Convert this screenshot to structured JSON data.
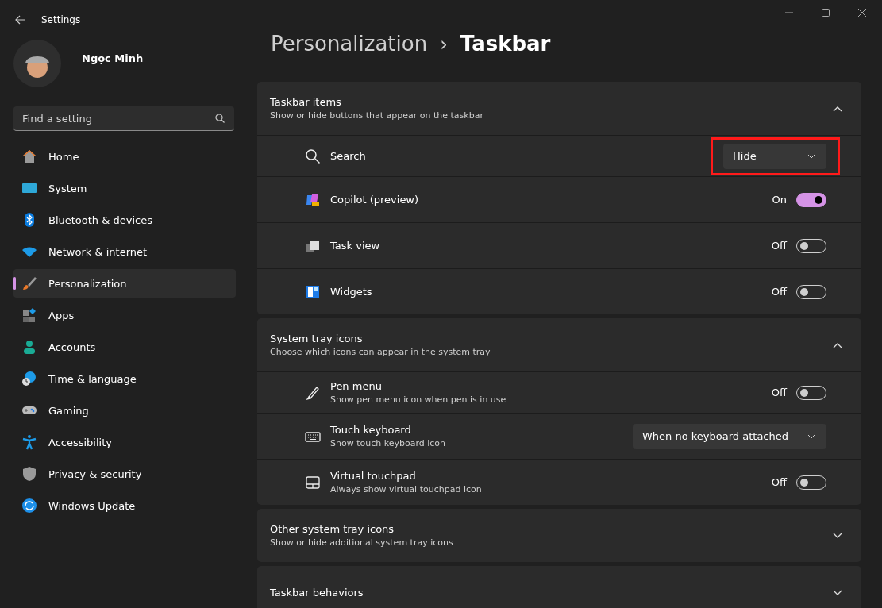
{
  "window": {
    "title": "Settings"
  },
  "user": {
    "name": "Ngọc Minh"
  },
  "search": {
    "placeholder": "Find a setting"
  },
  "sidebar": {
    "items": [
      {
        "label": "Home",
        "selected": false
      },
      {
        "label": "System",
        "selected": false
      },
      {
        "label": "Bluetooth & devices",
        "selected": false
      },
      {
        "label": "Network & internet",
        "selected": false
      },
      {
        "label": "Personalization",
        "selected": true
      },
      {
        "label": "Apps",
        "selected": false
      },
      {
        "label": "Accounts",
        "selected": false
      },
      {
        "label": "Time & language",
        "selected": false
      },
      {
        "label": "Gaming",
        "selected": false
      },
      {
        "label": "Accessibility",
        "selected": false
      },
      {
        "label": "Privacy & security",
        "selected": false
      },
      {
        "label": "Windows Update",
        "selected": false
      }
    ]
  },
  "breadcrumb": {
    "parent": "Personalization",
    "separator": "›",
    "current": "Taskbar"
  },
  "sections": [
    {
      "title": "Taskbar items",
      "subtitle": "Show or hide buttons that appear on the taskbar",
      "expanded": true,
      "rows": [
        {
          "kind": "dropdown",
          "label": "Search",
          "value": "Hide",
          "highlighted": true
        },
        {
          "kind": "toggle",
          "label": "Copilot (preview)",
          "on": true,
          "state_label": "On",
          "highlighted": false
        },
        {
          "kind": "toggle",
          "label": "Task view",
          "on": false,
          "state_label": "Off",
          "highlighted": false
        },
        {
          "kind": "toggle",
          "label": "Widgets",
          "on": false,
          "state_label": "Off",
          "highlighted": false
        }
      ]
    },
    {
      "title": "System tray icons",
      "subtitle": "Choose which icons can appear in the system tray",
      "expanded": true,
      "rows": [
        {
          "kind": "toggle",
          "label": "Pen menu",
          "description": "Show pen menu icon when pen is in use",
          "on": false,
          "state_label": "Off",
          "highlighted": false
        },
        {
          "kind": "dropdown",
          "label": "Touch keyboard",
          "description": "Show touch keyboard icon",
          "value": "When no keyboard attached",
          "highlighted": false
        },
        {
          "kind": "toggle",
          "label": "Virtual touchpad",
          "description": "Always show virtual touchpad icon",
          "on": false,
          "state_label": "Off",
          "highlighted": false
        }
      ]
    },
    {
      "title": "Other system tray icons",
      "subtitle": "Show or hide additional system tray icons",
      "expanded": false
    },
    {
      "title": "Taskbar behaviors",
      "expanded": false
    }
  ]
}
